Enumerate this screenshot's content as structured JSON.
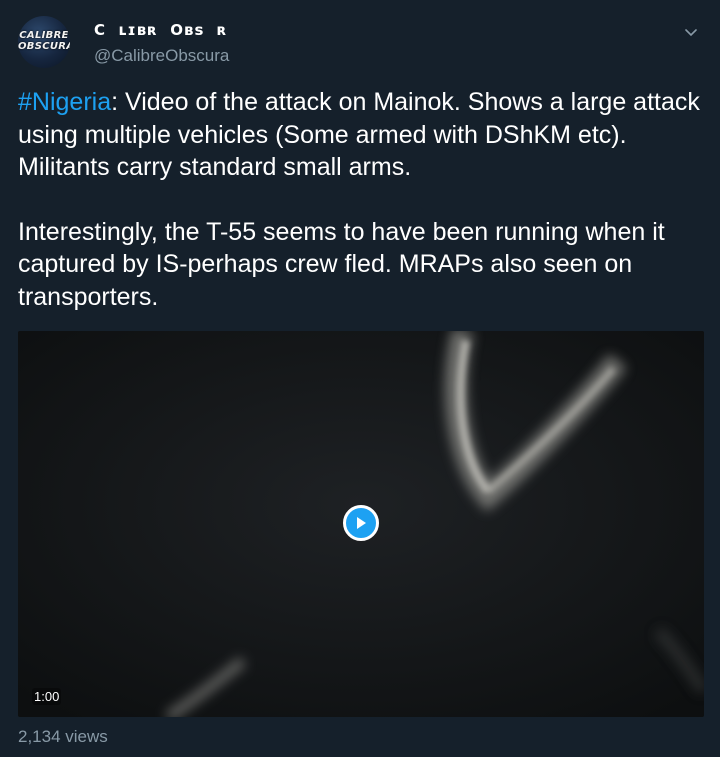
{
  "author": {
    "avatar_text_line1": "CALIBRE",
    "avatar_text_line2": "OBSCURA",
    "display_name": "C  ʟɪʙʀ  Oʙs  ʀ",
    "handle": "@CalibreObscura"
  },
  "tweet": {
    "hashtag": "#Nigeria",
    "paragraph1_rest": ": Video of the attack on Mainok. Shows a large attack using multiple vehicles (Some armed with DShKM etc). Militants carry standard small arms.",
    "paragraph2": "Interestingly, the T-55 seems to have been running when it captured by IS-perhaps crew fled. MRAPs also seen on transporters."
  },
  "media": {
    "duration": "1:00",
    "views": "2,134 views"
  },
  "icons": {
    "menu": "chevron-down-icon",
    "play": "play-icon"
  },
  "colors": {
    "background": "#15202b",
    "accent": "#1da1f2",
    "secondary_text": "#8899a6"
  }
}
